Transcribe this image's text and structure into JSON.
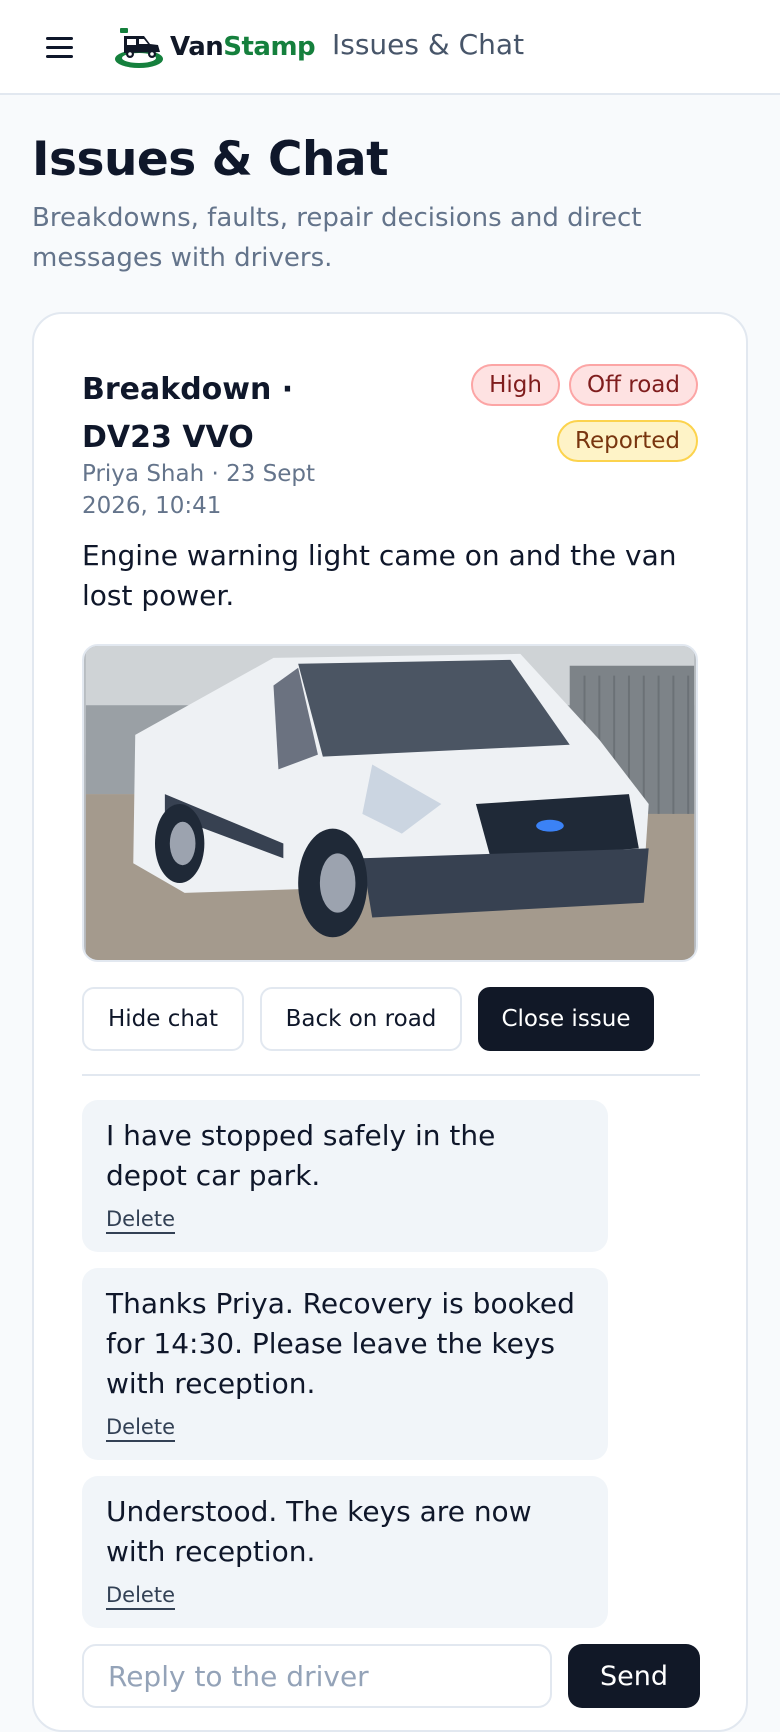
{
  "header": {
    "logo_prefix": "Van",
    "logo_suffix": "Stamp",
    "section_title": "Issues & Chat"
  },
  "page": {
    "title": "Issues & Chat",
    "subtitle": "Breakdowns, faults, repair decisions and direct messages with drivers."
  },
  "issue": {
    "title": "Breakdown · DV23 VVO",
    "meta": "Priya Shah · 23 Sept 2026, 10:41",
    "badges": {
      "priority": "High",
      "status_road": "Off road",
      "state": "Reported"
    },
    "description": "Engine warning light came on and the van lost power.",
    "actions": {
      "hide_chat": "Hide chat",
      "back_on_road": "Back on road",
      "close_issue": "Close issue"
    }
  },
  "chat": {
    "messages": [
      {
        "text": "I have stopped safely in the depot car park.",
        "delete_label": "Delete"
      },
      {
        "text": "Thanks Priya. Recovery is booked for 14:30. Please leave the keys with reception.",
        "delete_label": "Delete"
      },
      {
        "text": "Understood. The keys are now with reception.",
        "delete_label": "Delete"
      }
    ],
    "reply_placeholder": "Reply to the driver",
    "send_label": "Send"
  },
  "icons": {
    "menu": "hamburger-menu-icon",
    "logo": "van-logo-icon"
  },
  "colors": {
    "brand_green": "#15803d",
    "primary_dark": "#111827",
    "badge_high_bg": "#fee2e2",
    "badge_reported_bg": "#fef3c7"
  }
}
